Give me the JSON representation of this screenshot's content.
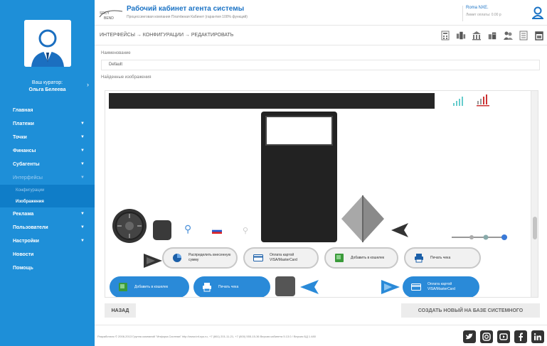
{
  "header": {
    "title": "Рабочий кабинет агента системы",
    "subtitle": "Процессинговая компания Платёжная Кабинет (гарантия 100% функций)",
    "logo_text": "SRCY / BEND",
    "user_name": "Roma NXE.",
    "user_balance": "Лимит оплаты: 0.00 р"
  },
  "sidebar": {
    "curator_label": "Ваш куратор:",
    "curator_name": "Ольга Белеева",
    "items": [
      {
        "label": "Главная",
        "chevron": false
      },
      {
        "label": "Платежи",
        "chevron": true
      },
      {
        "label": "Точки",
        "chevron": true
      },
      {
        "label": "Финансы",
        "chevron": true
      },
      {
        "label": "Субагенты",
        "chevron": true
      },
      {
        "label": "Интерфейсы",
        "chevron": true
      }
    ],
    "submenu": [
      {
        "label": "Конфигурации"
      },
      {
        "label": "Изображения"
      }
    ],
    "items2": [
      {
        "label": "Реклама",
        "chevron": true
      },
      {
        "label": "Пользователи",
        "chevron": true
      },
      {
        "label": "Настройки",
        "chevron": true
      },
      {
        "label": "Новости",
        "chevron": false
      },
      {
        "label": "Помощь",
        "chevron": false
      }
    ]
  },
  "breadcrumb": "ИНТЕРФЕЙСЫ → КОНФИГУРАЦИИ → РЕДАКТИРОВАТЬ",
  "toolbar_icons": [
    "calculator-icon",
    "terminal-icon",
    "bank-icon",
    "building-icon",
    "users-icon",
    "document-icon",
    "calendar-icon"
  ],
  "form": {
    "name_label": "Наименование",
    "name_value": "Default",
    "images_label": "Найденные изображения"
  },
  "gallery": {
    "pills": {
      "distribute": "Распределить внесенную сумму",
      "pay_card": "Оплата картой VISA/MasterCard",
      "add_wallet": "Добавить в кошелек",
      "print_check": "Печать чека",
      "add_wallet_blue": "Добавить в кошелек",
      "print_check_blue": "Печать чека",
      "pay_card_blue": "Оплата картой VISA/MasterCard"
    }
  },
  "buttons": {
    "back": "НАЗАД",
    "create": "СОЗДАТЬ НОВЫЙ НА БАЗЕ СИСТЕМНОГО"
  },
  "footer": "Разработано © 2006-2013 Группа компаний \"Информ-Система\" http://www.inf-sys.ru, +7 (861) 201-11-21, +7 (800) 555-15-36 Версия кабинета 5.13.0 / Версия БД 1.480",
  "social": [
    "twitter-icon",
    "instagram-icon",
    "youtube-icon",
    "facebook-icon",
    "linkedin-icon"
  ],
  "colors": {
    "sidebar": "#1e8fd8",
    "accent": "#1b73c5",
    "pill_blue": "#2a8ad8"
  }
}
